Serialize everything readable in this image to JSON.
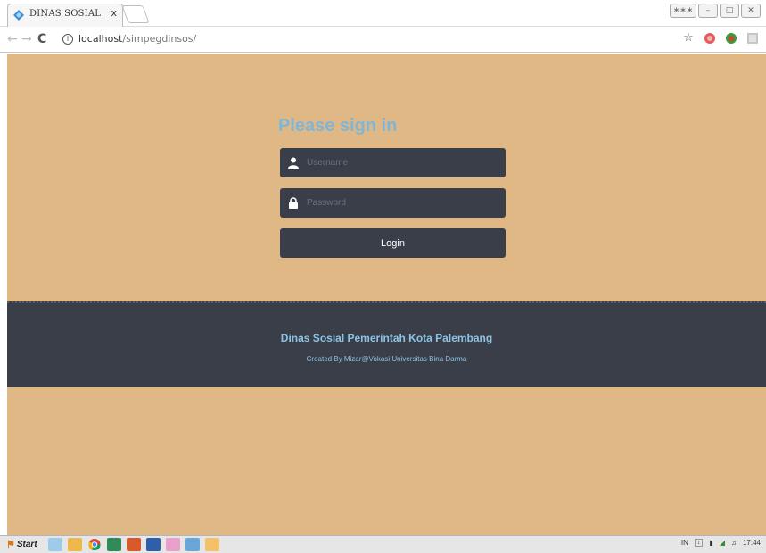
{
  "browser": {
    "tab_title": "DINAS SOSIAL",
    "tab_close": "x",
    "url_host": "localhost",
    "url_path": "/simpegdinsos/",
    "info_glyph": "i",
    "window_buttons": [
      "∗∗∗",
      "–",
      "□",
      "✕"
    ]
  },
  "login": {
    "title": "Please sign in",
    "username_placeholder": "Username",
    "password_placeholder": "Password",
    "login_label": "Login"
  },
  "footer": {
    "title": "Dinas Sosial Pemerintah Kota Palembang",
    "subtitle": "Created By Mizar@Vokasi Universitas Bina Darma"
  },
  "taskbar": {
    "start_label": "Start",
    "lang": "IN",
    "time": "17:44"
  },
  "colors": {
    "page_bg": "#dfb885",
    "dark_panel": "#3a3e49",
    "accent_blue": "#7fb6d8"
  }
}
